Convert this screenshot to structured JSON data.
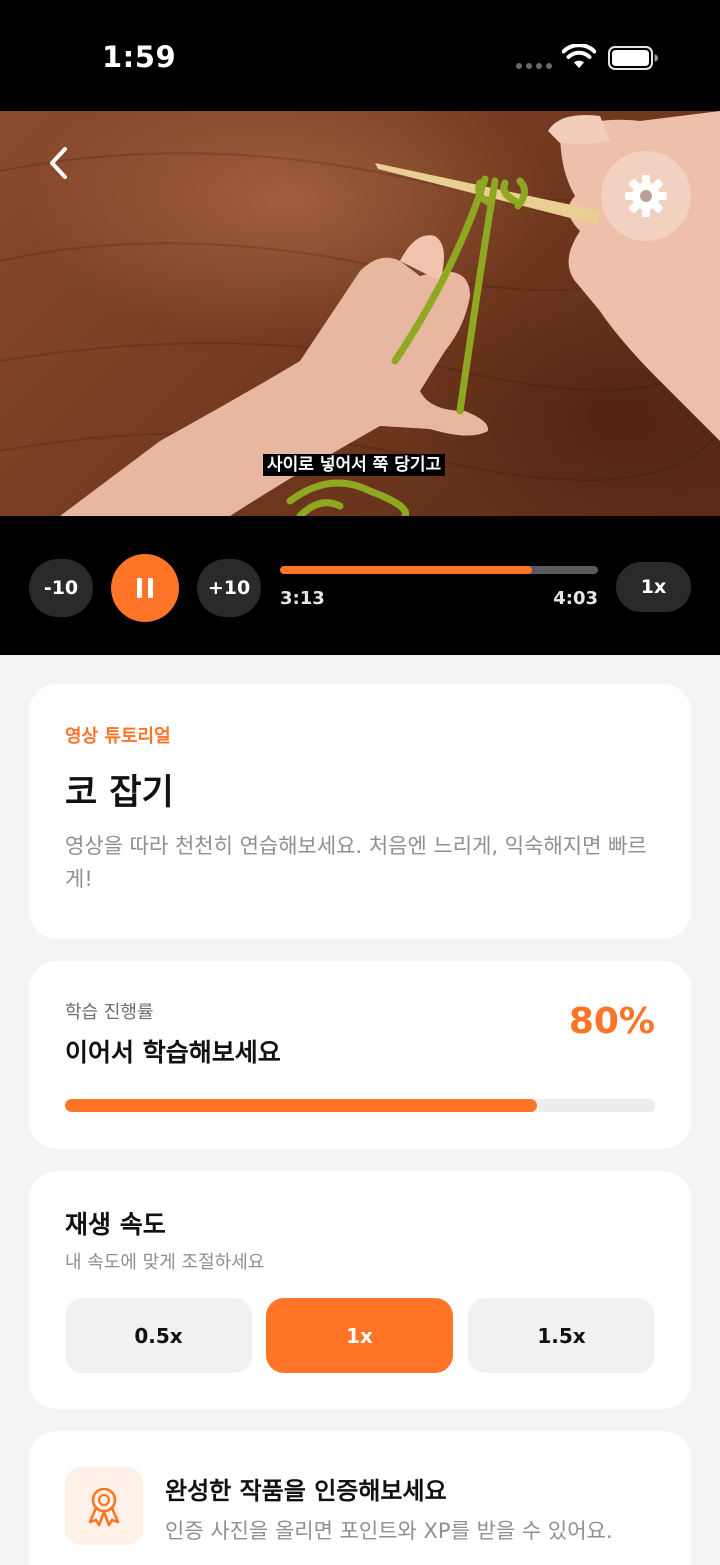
{
  "status_bar": {
    "time": "1:59"
  },
  "video": {
    "subtitle": "사이로 넣어서 쭉 당기고"
  },
  "controls": {
    "rewind_label": "-10",
    "forward_label": "+10",
    "current_time": "3:13",
    "total_time": "4:03",
    "progress_fraction": 0.793,
    "speed_label": "1x",
    "accent": "#ff7426"
  },
  "tutorial": {
    "eyebrow": "영상 튜토리얼",
    "title": "코 잡기",
    "description": "영상을 따라 천천히 연습해보세요. 처음엔 느리게, 익숙해지면 빠르게!"
  },
  "progress": {
    "label": "학습 진행률",
    "title": "이어서 학습해보세요",
    "percent_text": "80%",
    "percent_value": 80
  },
  "playback_speed": {
    "title": "재생 속도",
    "subtitle": "내 속도에 맞게 조절하세요",
    "options": [
      "0.5x",
      "1x",
      "1.5x"
    ],
    "selected": "1x"
  },
  "certify": {
    "title": "완성한 작품을 인증해보세요",
    "description": "인증 사진을 올리면 포인트와 XP를 받을 수 있어요.",
    "icon": "award-ribbon-icon"
  }
}
